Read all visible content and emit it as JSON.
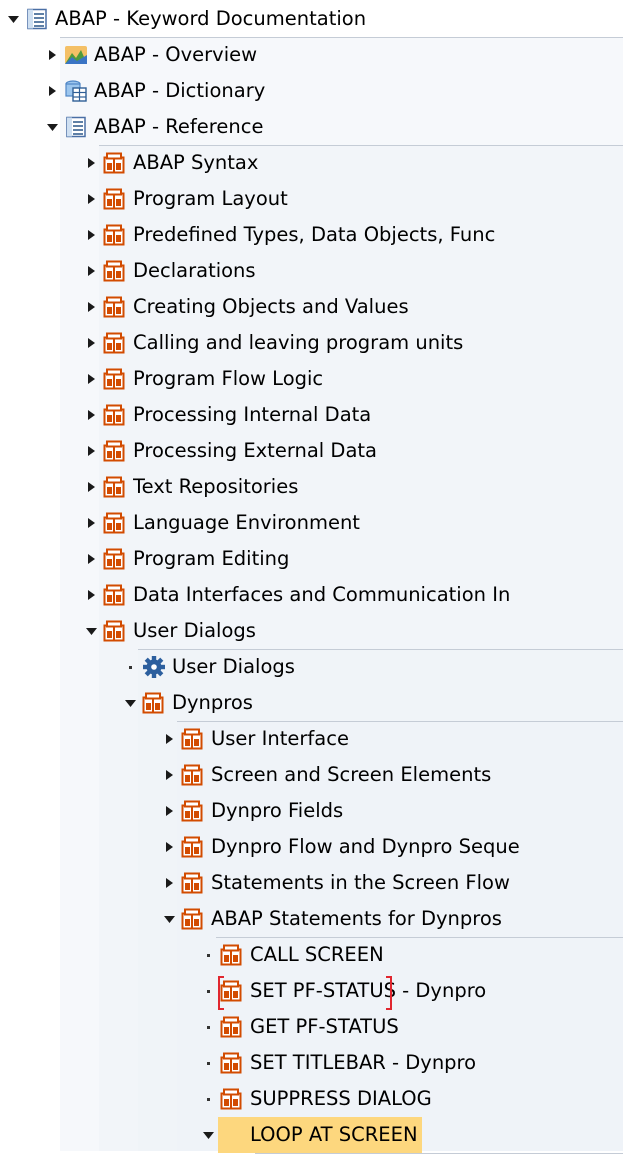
{
  "colors": {
    "folder_icon": "#d24b00",
    "group_bg": "#eef2f7",
    "group_rule": "#c5ccd6",
    "highlight": "#fdd77e",
    "focus_bracket": "#e0262f"
  },
  "tree": {
    "nodes": [
      {
        "label": "ABAP - Keyword Documentation",
        "level": 0,
        "state": "expanded",
        "icon": "document-list-icon"
      },
      {
        "label": "ABAP - Overview",
        "level": 1,
        "state": "collapsed",
        "icon": "overview-chart-icon"
      },
      {
        "label": "ABAP - Dictionary",
        "level": 1,
        "state": "collapsed",
        "icon": "dictionary-table-icon"
      },
      {
        "label": "ABAP - Reference",
        "level": 1,
        "state": "expanded",
        "icon": "document-list-icon"
      },
      {
        "label": "ABAP Syntax",
        "level": 2,
        "state": "collapsed",
        "icon": "book-icon"
      },
      {
        "label": "Program Layout",
        "level": 2,
        "state": "collapsed",
        "icon": "book-icon"
      },
      {
        "label": "Predefined Types, Data Objects, Func",
        "level": 2,
        "state": "collapsed",
        "icon": "book-icon"
      },
      {
        "label": "Declarations",
        "level": 2,
        "state": "collapsed",
        "icon": "book-icon"
      },
      {
        "label": "Creating Objects and Values",
        "level": 2,
        "state": "collapsed",
        "icon": "book-icon"
      },
      {
        "label": "Calling and leaving program units",
        "level": 2,
        "state": "collapsed",
        "icon": "book-icon"
      },
      {
        "label": "Program Flow Logic",
        "level": 2,
        "state": "collapsed",
        "icon": "book-icon"
      },
      {
        "label": "Processing Internal Data",
        "level": 2,
        "state": "collapsed",
        "icon": "book-icon"
      },
      {
        "label": "Processing External Data",
        "level": 2,
        "state": "collapsed",
        "icon": "book-icon"
      },
      {
        "label": "Text Repositories",
        "level": 2,
        "state": "collapsed",
        "icon": "book-icon"
      },
      {
        "label": "Language Environment",
        "level": 2,
        "state": "collapsed",
        "icon": "book-icon"
      },
      {
        "label": "Program Editing",
        "level": 2,
        "state": "collapsed",
        "icon": "book-icon"
      },
      {
        "label": "Data Interfaces and Communication In",
        "level": 2,
        "state": "collapsed",
        "icon": "book-icon"
      },
      {
        "label": "User Dialogs",
        "level": 2,
        "state": "expanded",
        "icon": "book-icon"
      },
      {
        "label": "User Dialogs",
        "level": 3,
        "state": "leaf",
        "icon": "gear-icon"
      },
      {
        "label": "Dynpros",
        "level": 3,
        "state": "expanded",
        "icon": "book-icon"
      },
      {
        "label": "User Interface",
        "level": 4,
        "state": "collapsed",
        "icon": "book-icon"
      },
      {
        "label": "Screen and Screen Elements",
        "level": 4,
        "state": "collapsed",
        "icon": "book-icon"
      },
      {
        "label": "Dynpro Fields",
        "level": 4,
        "state": "collapsed",
        "icon": "book-icon"
      },
      {
        "label": "Dynpro Flow and Dynpro Seque",
        "level": 4,
        "state": "collapsed",
        "icon": "book-icon"
      },
      {
        "label": "Statements in the Screen Flow",
        "level": 4,
        "state": "collapsed",
        "icon": "book-icon"
      },
      {
        "label": "ABAP Statements for Dynpros",
        "level": 4,
        "state": "expanded",
        "icon": "book-icon"
      },
      {
        "label": "CALL SCREEN",
        "level": 5,
        "state": "leaf",
        "icon": "book-icon"
      },
      {
        "label": "SET PF-STATUS - Dynpro",
        "level": 5,
        "state": "leaf",
        "icon": "book-icon",
        "focused": true
      },
      {
        "label": "GET PF-STATUS",
        "level": 5,
        "state": "leaf",
        "icon": "book-icon"
      },
      {
        "label": "SET TITLEBAR - Dynpro",
        "level": 5,
        "state": "leaf",
        "icon": "book-icon"
      },
      {
        "label": "SUPPRESS DIALOG",
        "level": 5,
        "state": "leaf",
        "icon": "book-icon"
      },
      {
        "label": "LOOP AT SCREEN",
        "level": 5,
        "state": "expanded",
        "icon": "book-icon",
        "selected": true
      }
    ]
  }
}
